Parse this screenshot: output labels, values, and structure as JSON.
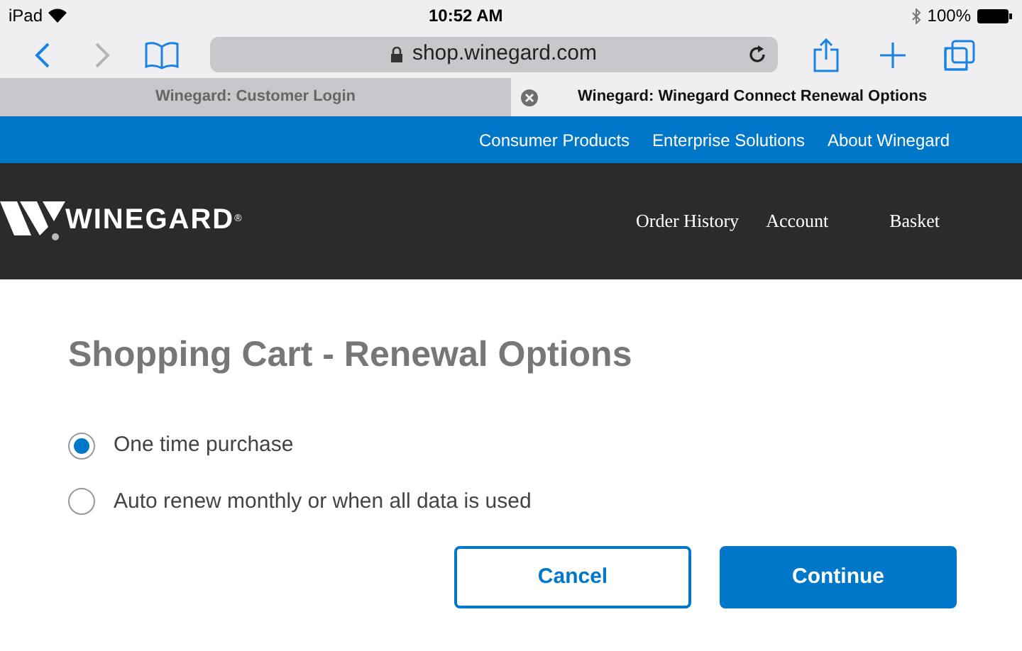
{
  "status_bar": {
    "device": "iPad",
    "time": "10:52 AM",
    "battery": "100%"
  },
  "address_bar": {
    "url": "shop.winegard.com"
  },
  "tabs": [
    {
      "label": "Winegard: Customer Login",
      "selected": false
    },
    {
      "label": "Winegard: Winegard Connect Renewal Options",
      "selected": true
    }
  ],
  "top_nav": [
    "Consumer Products",
    "Enterprise Solutions",
    "About Winegard"
  ],
  "header": {
    "logo_text": "WINEGARD",
    "logo_mark": "®",
    "links": [
      "Order History",
      "Account",
      "Basket"
    ]
  },
  "page_title": "Shopping Cart - Renewal Options",
  "options": [
    {
      "label": "One time purchase",
      "selected": true
    },
    {
      "label": "Auto renew monthly or when all data is used",
      "selected": false
    }
  ],
  "buttons": [
    {
      "label": "Cancel",
      "kind": "secondary"
    },
    {
      "label": "Continue",
      "kind": "primary"
    }
  ]
}
